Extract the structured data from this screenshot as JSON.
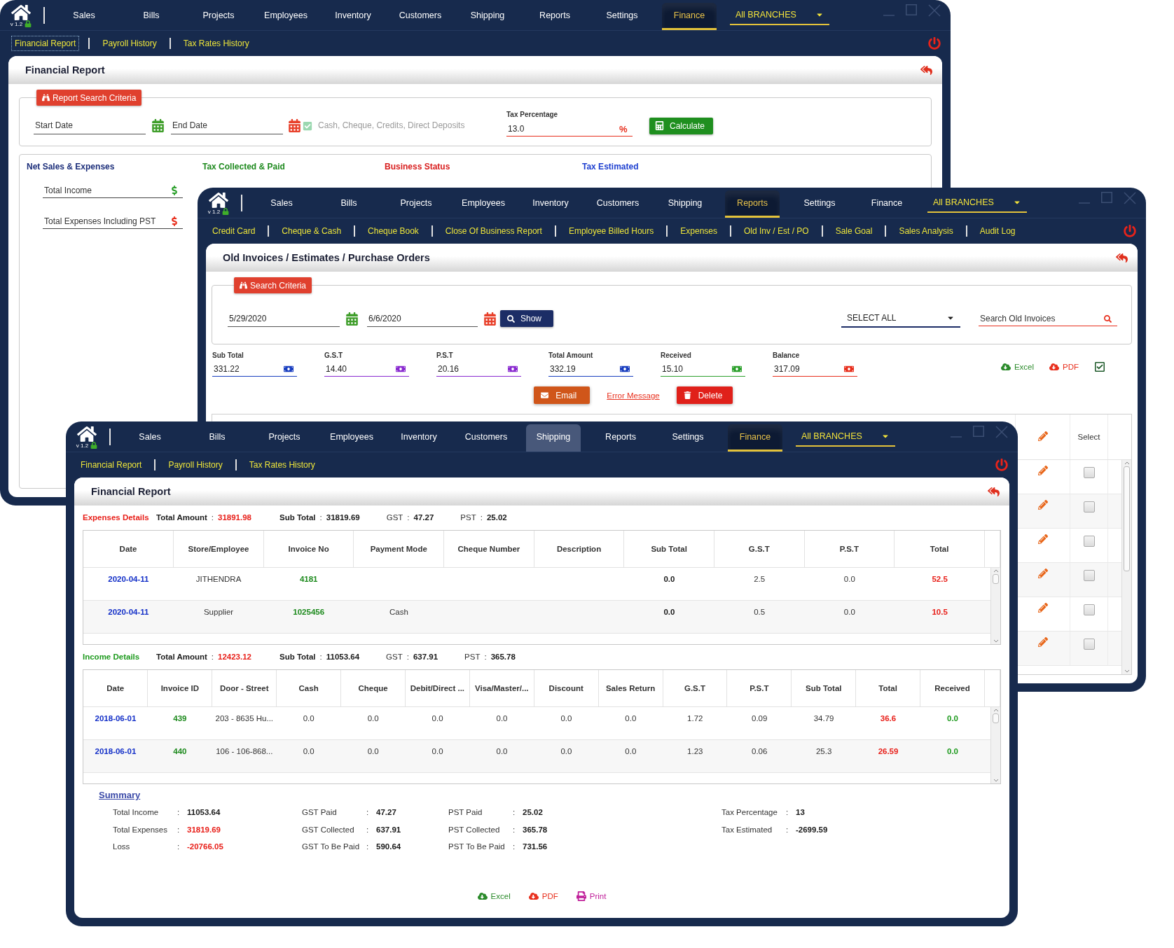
{
  "back_window": {
    "version": "v 1.2",
    "nav": [
      {
        "label": "Sales",
        "selected": false,
        "highlighted": false
      },
      {
        "label": "Bills",
        "selected": false,
        "highlighted": false
      },
      {
        "label": "Projects",
        "selected": false,
        "highlighted": false
      },
      {
        "label": "Employees",
        "selected": false,
        "highlighted": false
      },
      {
        "label": "Inventory",
        "selected": false,
        "highlighted": false
      },
      {
        "label": "Customers",
        "selected": false,
        "highlighted": false
      },
      {
        "label": "Shipping",
        "selected": false,
        "highlighted": false
      },
      {
        "label": "Reports",
        "selected": false,
        "highlighted": false
      },
      {
        "label": "Settings",
        "selected": false,
        "highlighted": false
      },
      {
        "label": "Finance",
        "selected": true,
        "highlighted": false
      }
    ],
    "branch": "All BRANCHES",
    "subnav": [
      {
        "label": "Financial Report",
        "selected": true
      },
      {
        "label": "Payroll History",
        "selected": false
      },
      {
        "label": "Tax Rates History",
        "selected": false
      }
    ],
    "title": "Financial Report",
    "criteria": {
      "legend": "Report Search Criteria",
      "start_date": {
        "placeholder": "Start Date"
      },
      "end_date": {
        "placeholder": "End Date"
      },
      "payment_types": {
        "placeholder": "Cash, Cheque, Credits, Direct Deposits"
      },
      "tax_percentage": {
        "label": "Tax Percentage",
        "value": "13.0",
        "unit": "%"
      },
      "calculate_button": "Calculate"
    },
    "sections": [
      {
        "label": "Net Sales & Expenses",
        "color": "#1c2e7a"
      },
      {
        "label": "Tax Collected & Paid",
        "color": "#1f8a1f"
      },
      {
        "label": "Business Status",
        "color": "#d81e1e"
      },
      {
        "label": "Tax Estimated",
        "color": "#1d3fd0"
      }
    ],
    "fields": [
      {
        "placeholder": "Total Income",
        "color": "#2ca02c"
      },
      {
        "placeholder": "Total Expenses Including PST",
        "color": "#e8301e"
      }
    ]
  },
  "middle_window": {
    "version": "v 1.2",
    "nav": [
      {
        "label": "Sales",
        "selected": false,
        "highlighted": false
      },
      {
        "label": "Bills",
        "selected": false,
        "highlighted": false
      },
      {
        "label": "Projects",
        "selected": false,
        "highlighted": false
      },
      {
        "label": "Employees",
        "selected": false,
        "highlighted": false
      },
      {
        "label": "Inventory",
        "selected": false,
        "highlighted": false
      },
      {
        "label": "Customers",
        "selected": false,
        "highlighted": false
      },
      {
        "label": "Shipping",
        "selected": false,
        "highlighted": false
      },
      {
        "label": "Reports",
        "selected": true,
        "highlighted": false
      },
      {
        "label": "Settings",
        "selected": false,
        "highlighted": false
      },
      {
        "label": "Finance",
        "selected": false,
        "highlighted": false
      }
    ],
    "branch": "All BRANCHES",
    "subnav": [
      {
        "label": "Credit Card",
        "selected": false
      },
      {
        "label": "Cheque & Cash",
        "selected": false
      },
      {
        "label": "Cheque Book",
        "selected": false
      },
      {
        "label": "Close Of Business Report",
        "selected": false
      },
      {
        "label": "Employee Billed Hours",
        "selected": false
      },
      {
        "label": "Expenses",
        "selected": false
      },
      {
        "label": "Old Inv / Est / PO",
        "selected": false
      },
      {
        "label": "Sale Goal",
        "selected": false
      },
      {
        "label": "Sales Analysis",
        "selected": false
      },
      {
        "label": "Audit Log",
        "selected": false
      }
    ],
    "title": "Old Invoices / Estimates / Purchase Orders",
    "criteria": {
      "legend": "Search Criteria",
      "from_date": "5/29/2020",
      "to_date": "6/6/2020",
      "show_button": "Show",
      "filter": "SELECT ALL",
      "search": {
        "placeholder": "Search Old Invoices"
      }
    },
    "totals": [
      {
        "label": "Sub Total",
        "value": "331.22",
        "color": "#1a3fc0"
      },
      {
        "label": "G.S.T",
        "value": "14.40",
        "color": "#8a2bd0"
      },
      {
        "label": "P.S.T",
        "value": "20.16",
        "color": "#8a2bd0"
      },
      {
        "label": "Total Amount",
        "value": "332.19",
        "color": "#1a3fc0"
      },
      {
        "label": "Received",
        "value": "15.10",
        "color": "#2ca02c"
      },
      {
        "label": "Balance",
        "value": "317.09",
        "color": "#e8301e"
      }
    ],
    "exports": [
      {
        "label": "Excel",
        "kind": "excel"
      },
      {
        "label": "PDF",
        "kind": "pdf"
      }
    ],
    "actions": {
      "email_button": "Email",
      "error_message_link": "Error Message",
      "delete_button": "Delete"
    },
    "table": {
      "select_header": "Select",
      "rows": [
        {
          "checked": false
        },
        {
          "checked": false
        },
        {
          "checked": false
        },
        {
          "checked": false
        },
        {
          "checked": false
        },
        {
          "checked": false
        }
      ]
    }
  },
  "front_window": {
    "version": "v 1.2",
    "nav": [
      {
        "label": "Sales",
        "selected": false,
        "highlighted": false
      },
      {
        "label": "Bills",
        "selected": false,
        "highlighted": false
      },
      {
        "label": "Projects",
        "selected": false,
        "highlighted": false
      },
      {
        "label": "Employees",
        "selected": false,
        "highlighted": false
      },
      {
        "label": "Inventory",
        "selected": false,
        "highlighted": false
      },
      {
        "label": "Customers",
        "selected": false,
        "highlighted": false
      },
      {
        "label": "Shipping",
        "selected": false,
        "highlighted": true
      },
      {
        "label": "Reports",
        "selected": false,
        "highlighted": false
      },
      {
        "label": "Settings",
        "selected": false,
        "highlighted": false
      },
      {
        "label": "Finance",
        "selected": true,
        "highlighted": false
      }
    ],
    "branch": "All BRANCHES",
    "subnav": [
      {
        "label": "Financial Report",
        "selected": false
      },
      {
        "label": "Payroll History",
        "selected": false
      },
      {
        "label": "Tax Rates History",
        "selected": false
      }
    ],
    "title": "Financial Report",
    "expenses": {
      "label": "Expenses Details",
      "summary": [
        {
          "label": "Total Amount",
          "colon": ":",
          "value": "31891.98",
          "kind": "total"
        },
        {
          "label": "Sub Total",
          "colon": ":",
          "value": "31819.69",
          "kind": "figure"
        },
        {
          "label": "GST",
          "colon": ":",
          "value": "47.27",
          "kind": "figure"
        },
        {
          "label": "PST",
          "colon": ":",
          "value": "25.02",
          "kind": "figure"
        }
      ],
      "columns": [
        {
          "label": "Date",
          "kind": "date"
        },
        {
          "label": "Store/Employee",
          "kind": "text"
        },
        {
          "label": "Invoice No",
          "kind": "reference"
        },
        {
          "label": "Payment Mode",
          "kind": "text"
        },
        {
          "label": "Cheque Number"
        },
        {
          "label": "Description"
        },
        {
          "label": "Sub Total",
          "kind": "subtotal"
        },
        {
          "label": "G.S.T",
          "kind": "amount"
        },
        {
          "label": "P.S.T",
          "kind": "amount"
        },
        {
          "label": "Total",
          "kind": "total"
        }
      ],
      "rows": [
        {
          "cells": [
            "2020-04-11",
            "JITHENDRA",
            "4181",
            null,
            null,
            null,
            "0.0",
            "2.5",
            "0.0",
            "52.5"
          ]
        },
        {
          "cells": [
            "2020-04-11",
            "Supplier",
            "1025456",
            "Cash",
            null,
            null,
            "0.0",
            "0.5",
            "0.0",
            "10.5"
          ]
        }
      ]
    },
    "income": {
      "label": "Income Details",
      "summary": [
        {
          "label": "Total Amount",
          "colon": ":",
          "value": "12423.12",
          "kind": "total"
        },
        {
          "label": "Sub Total",
          "colon": ":",
          "value": "11053.64",
          "kind": "figure"
        },
        {
          "label": "GST",
          "colon": ":",
          "value": "637.91",
          "kind": "figure"
        },
        {
          "label": "PST",
          "colon": ":",
          "value": "365.78",
          "kind": "figure"
        }
      ],
      "columns": [
        {
          "label": "Date",
          "kind": "date"
        },
        {
          "label": "Invoice ID",
          "kind": "reference"
        },
        {
          "label": "Door - Street",
          "kind": "text"
        },
        {
          "label": "Cash",
          "kind": "amount"
        },
        {
          "label": "Cheque",
          "kind": "amount"
        },
        {
          "label": "Debit/Direct ...",
          "kind": "amount"
        },
        {
          "label": "Visa/Master/...",
          "kind": "amount"
        },
        {
          "label": "Discount",
          "kind": "amount"
        },
        {
          "label": "Sales Return",
          "kind": "amount"
        },
        {
          "label": "G.S.T",
          "kind": "amount"
        },
        {
          "label": "P.S.T",
          "kind": "amount"
        },
        {
          "label": "Sub Total",
          "kind": "amount"
        },
        {
          "label": "Total",
          "kind": "total"
        },
        {
          "label": "Received",
          "kind": "received"
        }
      ],
      "rows": [
        {
          "cells": [
            "2018-06-01",
            "439",
            "203 - 8635 Hu...",
            "0.0",
            "0.0",
            "0.0",
            "0.0",
            "0.0",
            "0.0",
            "1.72",
            "0.09",
            "34.79",
            "36.6",
            "0.0"
          ]
        },
        {
          "cells": [
            "2018-06-01",
            "440",
            "106 - 106-868...",
            "0.0",
            "0.0",
            "0.0",
            "0.0",
            "0.0",
            "0.0",
            "1.23",
            "0.06",
            "25.3",
            "26.59",
            "0.0"
          ]
        }
      ]
    },
    "summary": {
      "title": "Summary",
      "groups": [
        {
          "items": [
            {
              "label": "Total Income",
              "colon": ":",
              "value": "11053.64",
              "kind": "figure"
            },
            {
              "label": "Total Expenses",
              "colon": ":",
              "value": "31819.69",
              "kind": "expense"
            },
            {
              "label": "Loss",
              "colon": ":",
              "value": "-20766.05",
              "kind": "expense"
            }
          ]
        },
        {
          "items": [
            {
              "label": "GST Paid",
              "colon": ":",
              "value": "47.27",
              "kind": "figure"
            },
            {
              "label": "GST Collected",
              "colon": ":",
              "value": "637.91",
              "kind": "figure"
            },
            {
              "label": "GST To Be Paid",
              "colon": ":",
              "value": "590.64",
              "kind": "figure"
            }
          ]
        },
        {
          "items": [
            {
              "label": "PST Paid",
              "colon": ":",
              "value": "25.02",
              "kind": "figure"
            },
            {
              "label": "PST Collected",
              "colon": ":",
              "value": "365.78",
              "kind": "figure"
            },
            {
              "label": "PST To Be Paid",
              "colon": ":",
              "value": "731.56",
              "kind": "figure"
            }
          ]
        },
        {
          "items": [
            {
              "label": "Tax Percentage",
              "colon": ":",
              "value": "13",
              "kind": "figure"
            },
            {
              "label": "Tax Estimated",
              "colon": ":",
              "value": "-2699.59",
              "kind": "figure"
            }
          ]
        }
      ]
    },
    "exports": [
      {
        "label": "Excel",
        "kind": "excel"
      },
      {
        "label": "PDF",
        "kind": "pdf"
      },
      {
        "label": "Print",
        "kind": "print"
      }
    ]
  }
}
